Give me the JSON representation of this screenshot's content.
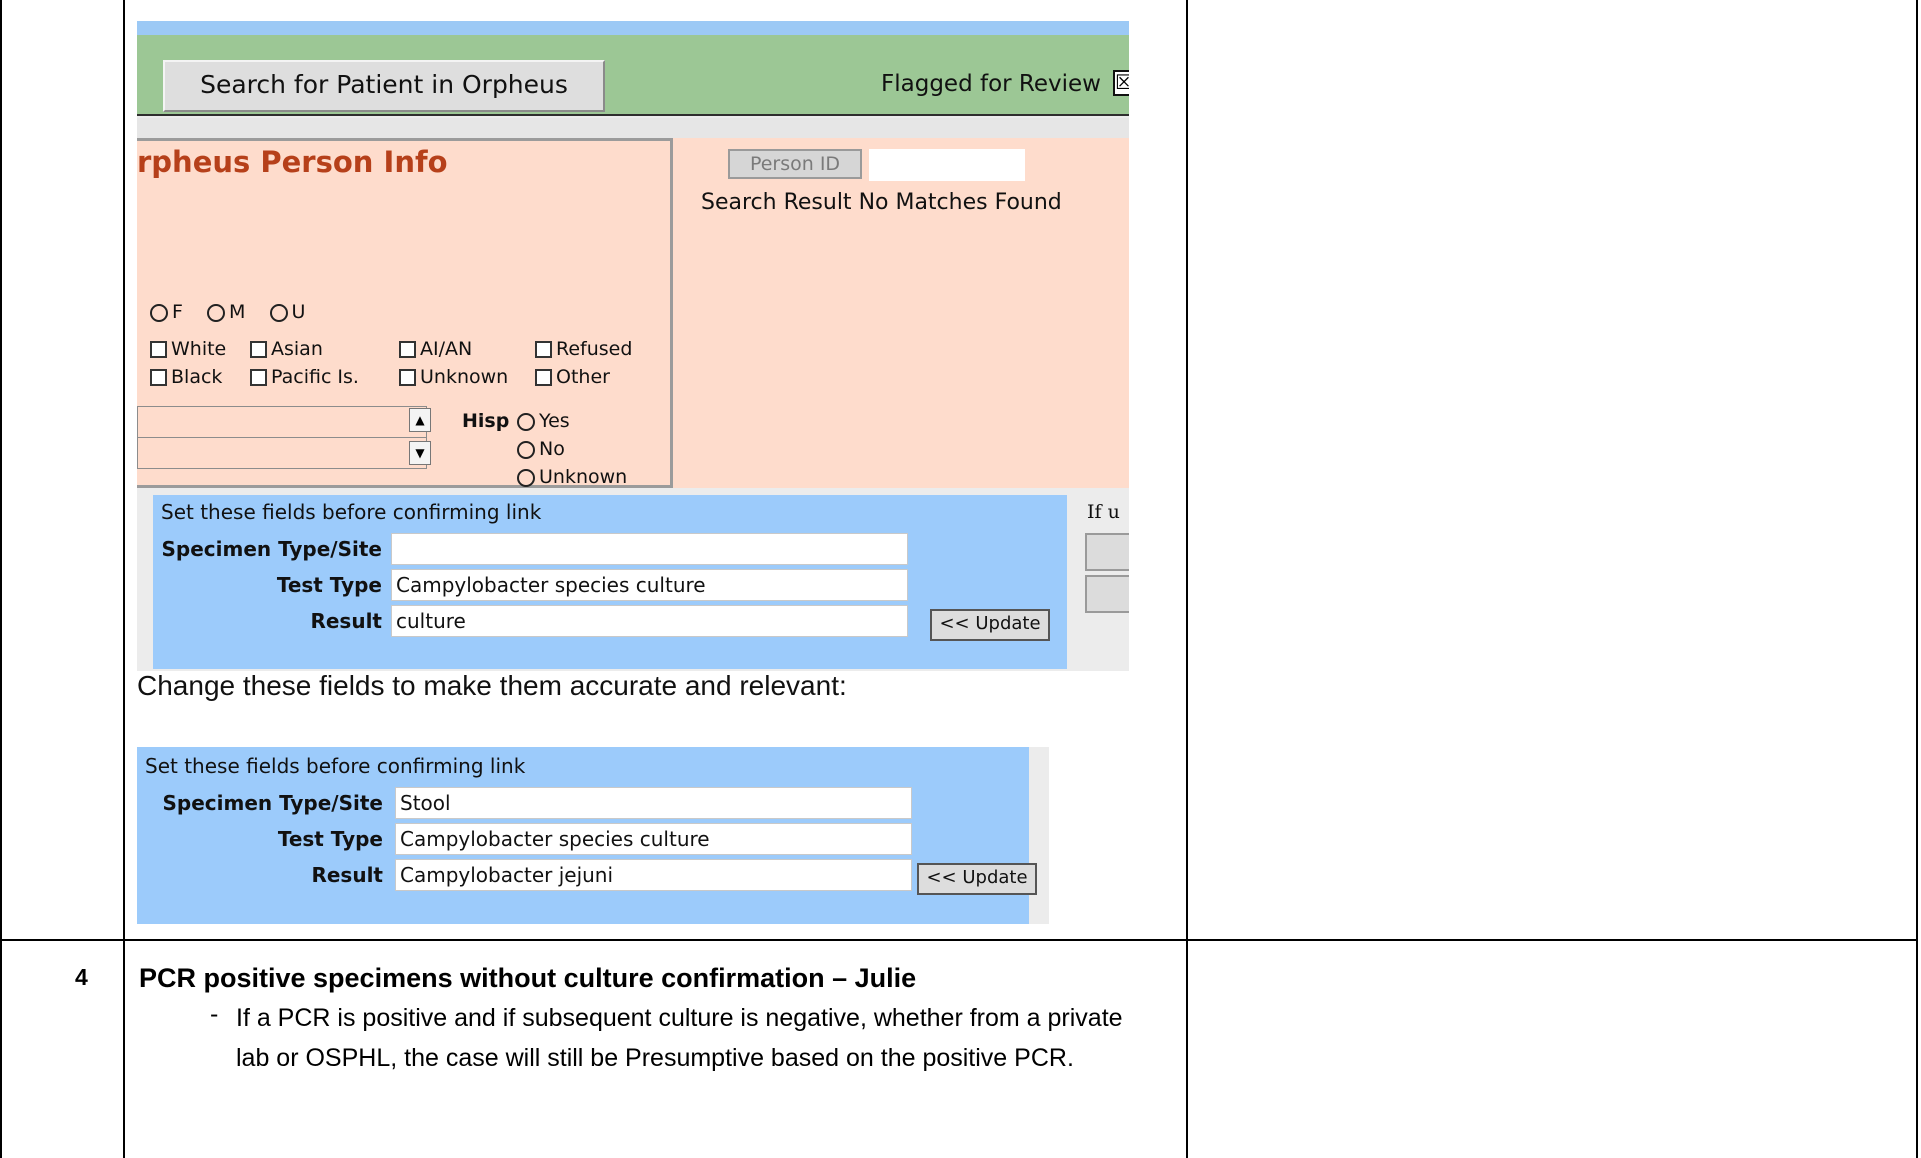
{
  "row4": {
    "number": "4",
    "heading": "PCR positive specimens without culture confirmation – Julie",
    "bullet_marker": "-",
    "bullet_text": "If a PCR is positive and if subsequent culture is negative, whether from a private lab or OSPHL, the case will still be Presumptive based on the positive PCR."
  },
  "screenshot1": {
    "search_button": "Search for Patient in Orpheus",
    "flag_label": "Flagged for Review",
    "flag_checked_mark": "☒",
    "person_panel_title": "rpheus Person Info",
    "person_id_button": "Person ID",
    "person_id_value": "",
    "search_result_label": "Search Result",
    "search_result_value": "No Matches Found",
    "sex_options": [
      "F",
      "M",
      "U"
    ],
    "race_options_row1": [
      "White",
      "Asian",
      "AI/AN",
      "Refused"
    ],
    "race_options_row2": [
      "Black",
      "Pacific Is.",
      "Unknown",
      "Other"
    ],
    "hisp_label": "Hisp",
    "hisp_options": [
      "Yes",
      "No",
      "Unknown"
    ],
    "set_fields_title": "Set these fields before confirming link",
    "specimen_label": "Specimen Type/Site",
    "specimen_value": "",
    "test_type_label": "Test Type",
    "test_type_value": "Campylobacter species culture",
    "result_label": "Result",
    "result_value": "culture",
    "update_button": "<< Update",
    "side_text": "If u"
  },
  "caption": "Change these fields to make them accurate and relevant:",
  "screenshot2": {
    "set_fields_title": "Set these fields before confirming link",
    "specimen_label": "Specimen Type/Site",
    "specimen_value": "Stool",
    "test_type_label": "Test Type",
    "test_type_value": "Campylobacter species culture",
    "result_label": "Result",
    "result_value": "Campylobacter jejuni",
    "update_button": "<< Update"
  }
}
